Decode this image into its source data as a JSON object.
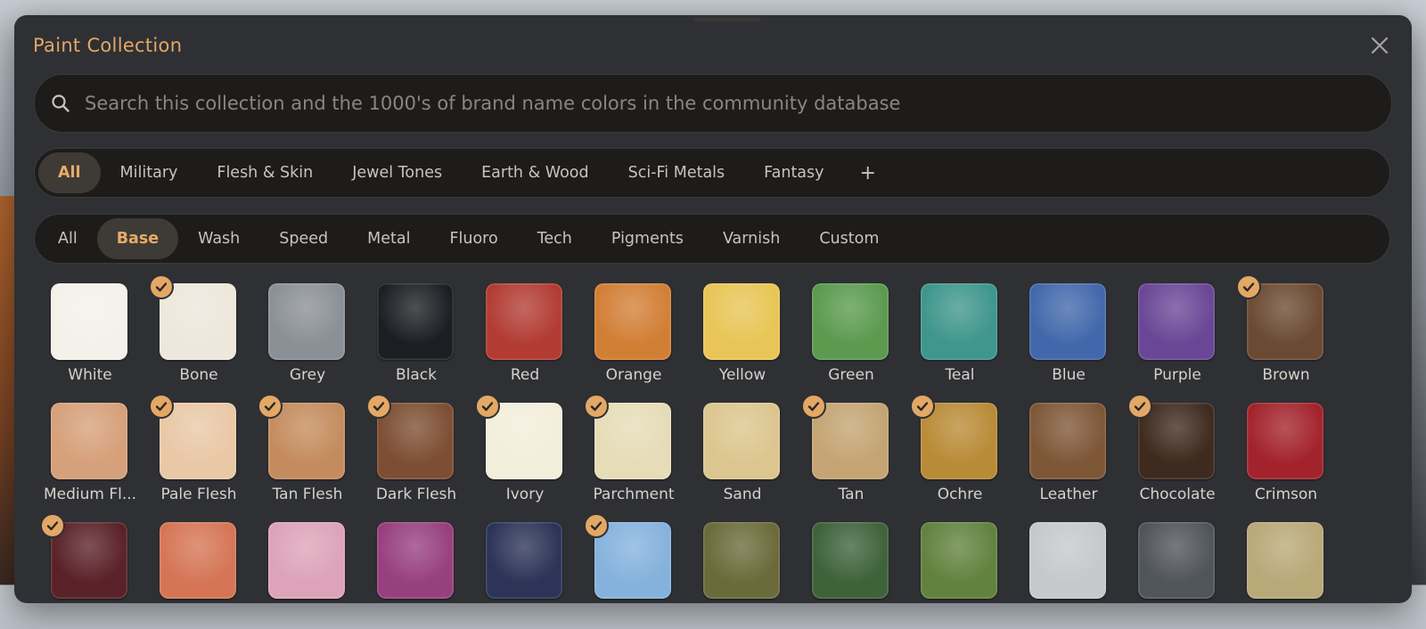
{
  "dialog": {
    "title": "Paint Collection"
  },
  "search": {
    "placeholder": "Search this collection and the 1000's of brand name colors in the community database",
    "value": ""
  },
  "collections": {
    "tabs": [
      "All",
      "Military",
      "Flesh & Skin",
      "Jewel Tones",
      "Earth & Wood",
      "Sci-Fi Metals",
      "Fantasy"
    ],
    "active": "All",
    "add_label": "+"
  },
  "paint_types": {
    "tabs": [
      "All",
      "Base",
      "Wash",
      "Speed",
      "Metal",
      "Fluoro",
      "Tech",
      "Pigments",
      "Varnish",
      "Custom"
    ],
    "active": "Base"
  },
  "swatches": [
    {
      "name": "White",
      "color": "#f4f1ea",
      "owned": false
    },
    {
      "name": "Bone",
      "color": "#ede7dc",
      "owned": true
    },
    {
      "name": "Grey",
      "color": "#8b9097",
      "owned": false
    },
    {
      "name": "Black",
      "color": "#1c1e23",
      "owned": false
    },
    {
      "name": "Red",
      "color": "#b23c34",
      "owned": false
    },
    {
      "name": "Orange",
      "color": "#d27f36",
      "owned": false
    },
    {
      "name": "Yellow",
      "color": "#e8c556",
      "owned": false
    },
    {
      "name": "Green",
      "color": "#5b9a4f",
      "owned": false
    },
    {
      "name": "Teal",
      "color": "#3f968c",
      "owned": false
    },
    {
      "name": "Blue",
      "color": "#4268ab",
      "owned": false
    },
    {
      "name": "Purple",
      "color": "#6a4796",
      "owned": false
    },
    {
      "name": "Brown",
      "color": "#6b4a33",
      "owned": true
    },
    {
      "name": "Medium Flesh",
      "display": "Medium Fl...",
      "color": "#d6a07a",
      "owned": false
    },
    {
      "name": "Pale Flesh",
      "color": "#e9c8a6",
      "owned": true
    },
    {
      "name": "Tan Flesh",
      "color": "#c48c5e",
      "owned": true
    },
    {
      "name": "Dark Flesh",
      "color": "#7d4e33",
      "owned": true
    },
    {
      "name": "Ivory",
      "color": "#f3eedb",
      "owned": true
    },
    {
      "name": "Parchment",
      "color": "#e6dcb7",
      "owned": true
    },
    {
      "name": "Sand",
      "color": "#dcc68f",
      "owned": false
    },
    {
      "name": "Tan",
      "color": "#c4a473",
      "owned": true
    },
    {
      "name": "Ochre",
      "color": "#b98b37",
      "owned": true
    },
    {
      "name": "Leather",
      "color": "#7e5737",
      "owned": false
    },
    {
      "name": "Chocolate",
      "color": "#3e2a1e",
      "owned": true
    },
    {
      "name": "Crimson",
      "color": "#a3232c",
      "owned": false
    },
    {
      "name": "",
      "color": "#5a2128",
      "owned": true
    },
    {
      "name": "",
      "color": "#d57556",
      "owned": false
    },
    {
      "name": "",
      "color": "#dda3b8",
      "owned": false
    },
    {
      "name": "",
      "color": "#97407f",
      "owned": false
    },
    {
      "name": "",
      "color": "#2c3457",
      "owned": false
    },
    {
      "name": "",
      "color": "#85b2dc",
      "owned": true
    },
    {
      "name": "",
      "color": "#6b6a3a",
      "owned": false
    },
    {
      "name": "",
      "color": "#3e623a",
      "owned": false
    },
    {
      "name": "",
      "color": "#62823f",
      "owned": false
    },
    {
      "name": "",
      "color": "#c6c8cc",
      "owned": false
    },
    {
      "name": "",
      "color": "#50545b",
      "owned": false
    },
    {
      "name": "",
      "color": "#b9a878",
      "owned": false
    }
  ]
}
